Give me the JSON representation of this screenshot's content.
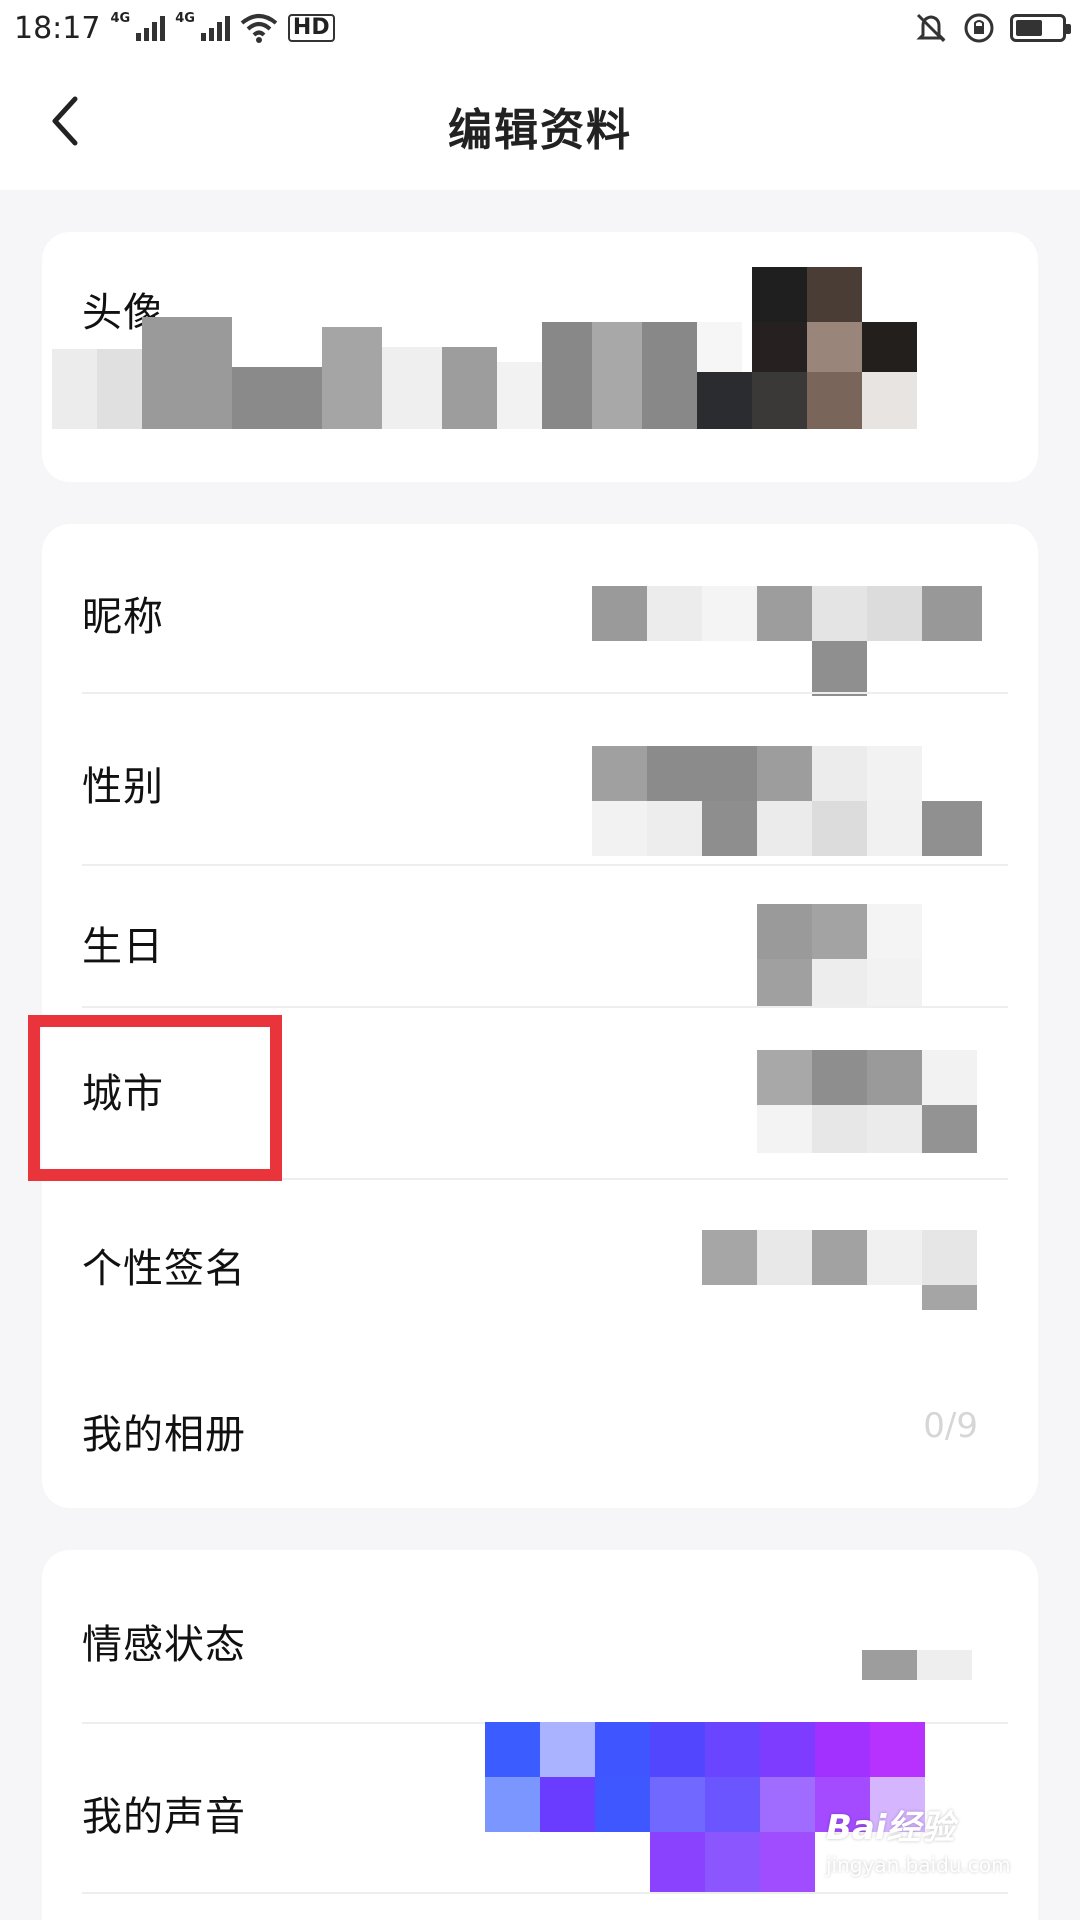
{
  "status_bar": {
    "time": "18:17",
    "network_1": "4G",
    "network_2": "4G",
    "hd_label": "HD",
    "battery_level": 0.6
  },
  "header": {
    "back_icon": "chevron-left-icon",
    "title": "编辑资料"
  },
  "profile_card": {
    "avatar_label": "头像"
  },
  "info_card": {
    "rows": [
      {
        "label": "昵称"
      },
      {
        "label": "性别"
      },
      {
        "label": "生日"
      },
      {
        "label": "城市"
      },
      {
        "label": "个性签名"
      },
      {
        "label": "我的相册",
        "value": "0/9"
      }
    ]
  },
  "extra_card": {
    "rows": [
      {
        "label": "情感状态"
      },
      {
        "label": "我的声音"
      }
    ]
  },
  "watermark": {
    "brand": "Bai经验",
    "url": "jingyan.baidu.com"
  },
  "colors": {
    "highlight": "#e8343a",
    "voice_gradient_start": "#3a5cff",
    "voice_gradient_end": "#b832ff"
  }
}
